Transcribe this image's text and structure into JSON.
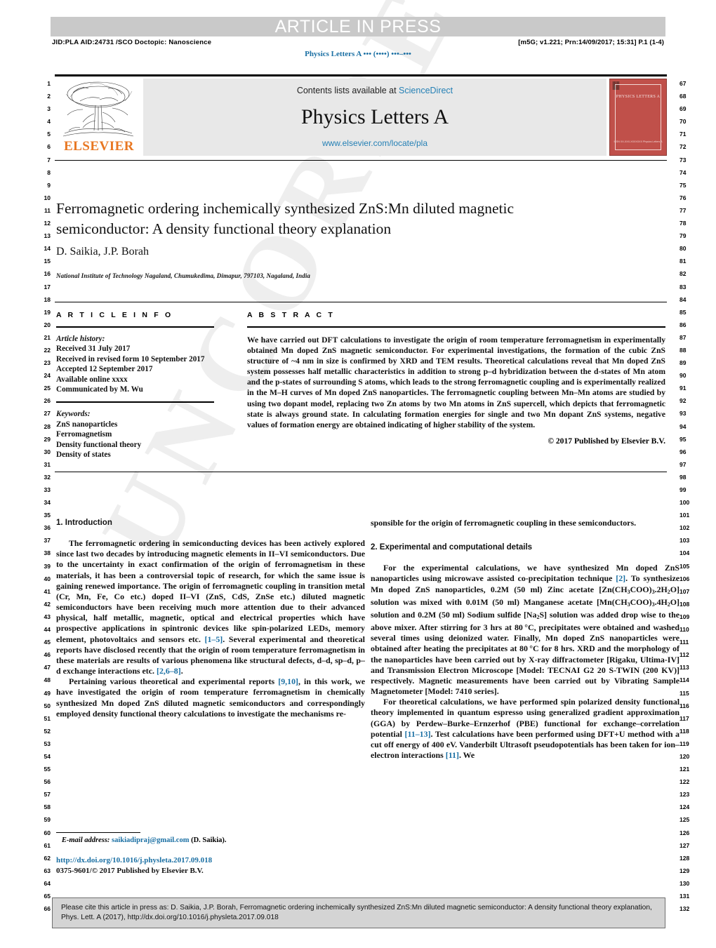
{
  "header": {
    "banner": "ARTICLE IN PRESS",
    "jid": "JID:PLA   AID:24731 /SCO   Doctopic: Nanoscience",
    "prn": "[m5G; v1.221; Prn:14/09/2017; 15:31] P.1 (1-4)",
    "running_head": "Physics Letters A ••• (••••) •••–•••"
  },
  "masthead": {
    "publisher": "ELSEVIER",
    "contents_prefix": "Contents lists available at ",
    "contents_link": "ScienceDirect",
    "journal_title": "Physics Letters A",
    "journal_url": "www.elsevier.com/locate/pla",
    "cover_title": "PHYSICS LETTERS A",
    "cover_footer": "ISSN XX-XXX-XXXXXXX\nPhysics Letters A"
  },
  "article": {
    "title": "Ferromagnetic ordering inchemically synthesized ZnS:Mn diluted magnetic semiconductor: A density functional theory explanation",
    "authors": "D. Saikia, J.P. Borah",
    "affiliation": "National Institute of Technology Nagaland, Chumukedima, Dimapur, 797103, Nagaland, India"
  },
  "info": {
    "label": "A R T I C L E    I N F O",
    "history_label": "Article history:",
    "history": [
      "Received 31 July 2017",
      "Received in revised form 10 September 2017",
      "Accepted 12 September 2017",
      "Available online xxxx",
      "Communicated by M. Wu"
    ],
    "keywords_label": "Keywords:",
    "keywords": [
      "ZnS nanoparticles",
      "Ferromagnetism",
      "Density functional theory",
      "Density of states"
    ]
  },
  "abstract": {
    "label": "A B S T R A C T",
    "text": "We have carried out DFT calculations to investigate the origin of room temperature ferromagnetism in experimentally obtained Mn doped ZnS magnetic semiconductor. For experimental investigations, the formation of the cubic ZnS structure of ~4 nm in size is confirmed by XRD and TEM results. Theoretical calculations reveal that Mn doped ZnS system possesses half metallic characteristics in addition to strong p–d hybridization between the d-states of Mn atom and the p-states of surrounding S atoms, which leads to the strong ferromagnetic coupling and is experimentally realized in the M–H curves of Mn doped ZnS nanoparticles. The ferromagnetic coupling between Mn–Mn atoms are studied by using two dopant model, replacing two Zn atoms by two Mn atoms in ZnS supercell, which depicts that ferromagnetic state is always ground state. In calculating formation energies for single and two Mn dopant ZnS systems, negative values of formation energy are obtained indicating of higher stability of the system.",
    "copyright": "© 2017 Published by Elsevier B.V."
  },
  "body": {
    "section1_heading": "1. Introduction",
    "section1_p1_a": "The ferromagnetic ordering in semiconducting devices has been actively explored since last two decades by introducing magnetic elements in II–VI semiconductors. Due to the uncertainty in exact confirmation of the origin of ferromagnetism in these materials, it has been a controversial topic of research, for which the same issue is gaining renewed importance. The origin of ferromagnetic coupling in transition metal (Cr, Mn, Fe, Co etc.) doped II–VI (ZnS, CdS, ZnSe etc.) diluted magnetic semiconductors have been receiving much more attention due to their advanced physical, half metallic, magnetic, optical and electrical properties which have prospective applications in spintronic devices like spin-polarized LEDs, memory element, photovoltaics and sensors etc. ",
    "section1_p1_ref1": "[1–5]",
    "section1_p1_b": ". Several experimental and theoretical reports have disclosed recently that the origin of room temperature ferromagnetism in these materials are results of various phenomena like structural defects, d–d, sp–d, p–d exchange interactions etc. ",
    "section1_p1_ref2": "[2,6–8]",
    "section1_p1_c": ".",
    "section1_p2_a": "Pertaining various theoretical and experimental reports ",
    "section1_p2_ref": "[9,10]",
    "section1_p2_b": ", in this work, we have investigated the origin of room temperature ferromagnetism in chemically synthesized Mn doped ZnS diluted magnetic semiconductors and correspondingly employed density functional theory calculations to investigate the mechanisms re-",
    "section1_cont": "sponsible for the origin of ferromagnetic coupling in these semiconductors.",
    "section2_heading": "2. Experimental and computational details",
    "section2_p1_a": "For the experimental calculations, we have synthesized Mn doped ZnS nanoparticles using microwave assisted co-precipitation technique ",
    "section2_p1_ref": "[2]",
    "section2_p1_b": ". To synthesize Mn doped ZnS nanoparticles, 0.2M (50 ml) Zinc acetate [Zn(CH3COO)3.2H2O] solution was mixed with 0.01M (50 ml) Manganese acetate [Mn(CH3COO)3.4H2O] solution and 0.2M (50 ml) Sodium sulfide [Na2S] solution was added drop wise to the above mixer. After stirring for 3 hrs at 80 °C, precipitates were obtained and washed several times using deionized water. Finally, Mn doped ZnS nanoparticles were obtained after heating the precipitates at 80 °C for 8 hrs. XRD and the morphology of the nanoparticles have been carried out by X-ray diffractometer [Rigaku, Ultima-IV] and Transmission Electron Microscope [Model: TECNAI G2 20 S-TWIN (200 KV)] respectively. Magnetic measurements have been carried out by Vibrating Sample Magnetometer [Model: 7410 series].",
    "section2_p2_a": "For theoretical calculations, we have performed spin polarized density functional theory implemented in quantum espresso using generalized gradient approximation (GGA) by Perdew–Burke–Ernzerhof (PBE) functional for exchange–correlation potential ",
    "section2_p2_ref1": "[11–13]",
    "section2_p2_b": ". Test calculations have been performed using DFT+U method with a cut off energy of 400 eV. Vanderbilt Ultrasoft pseudopotentials has been taken for ion–electron interactions ",
    "section2_p2_ref2": "[11]",
    "section2_p2_c": ". We"
  },
  "footnote": {
    "label": "E-mail address:",
    "email": "saikiadipraj@gmail.com",
    "suffix": " (D. Saikia).",
    "doi": "http://dx.doi.org/10.1016/j.physleta.2017.09.018",
    "issn": "0375-9601/© 2017 Published by Elsevier B.V."
  },
  "cite_box": "Please cite this article in press as: D. Saikia, J.P. Borah, Ferromagnetic ordering inchemically synthesized ZnS:Mn diluted magnetic semiconductor: A density functional theory explanation, Phys. Lett. A (2017), http://dx.doi.org/10.1016/j.physleta.2017.09.018",
  "watermark": "UNCORRECTED PROOF",
  "line_numbers": {
    "left_start": 1,
    "left_end": 66,
    "right_start": 67,
    "right_end": 132
  },
  "colors": {
    "link": "#1a6fa3",
    "banner_bg": "#c9c9c9",
    "panel_bg": "#e8e8e8",
    "elsevier_orange": "#E87722",
    "cover_red": "#c0504a",
    "cite_bg": "#d4d4d4"
  }
}
